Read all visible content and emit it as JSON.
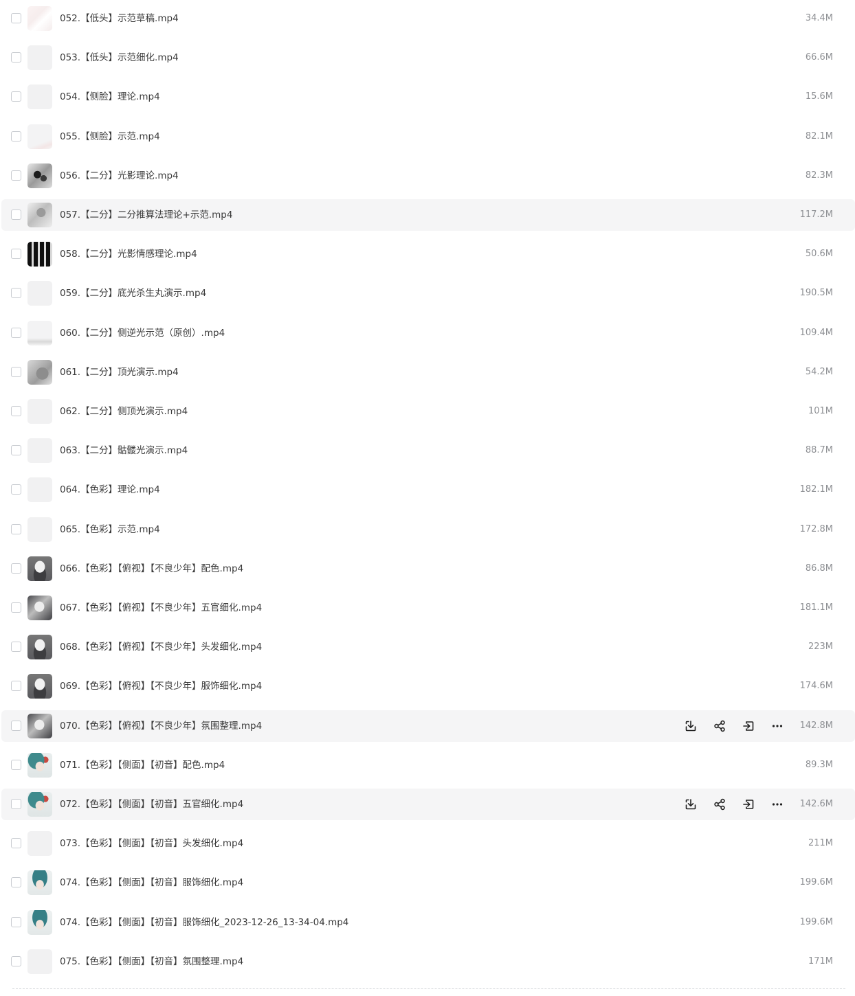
{
  "files": [
    {
      "name": "052.【低头】示范草稿.mp4",
      "size": "34.4M",
      "thumb": "t-sketch"
    },
    {
      "name": "053.【低头】示范细化.mp4",
      "size": "66.6M",
      "thumb": ""
    },
    {
      "name": "054.【侧脸】理论.mp4",
      "size": "15.6M",
      "thumb": ""
    },
    {
      "name": "055.【侧脸】示范.mp4",
      "size": "82.1M",
      "thumb": "t-sketch2"
    },
    {
      "name": "056.【二分】光影理论.mp4",
      "size": "82.3M",
      "thumb": "t-bw"
    },
    {
      "name": "057.【二分】二分推算法理论+示范.mp4",
      "size": "117.2M",
      "thumb": "t-gray",
      "highlighted": true
    },
    {
      "name": "058.【二分】光影情感理论.mp4",
      "size": "50.6M",
      "thumb": "t-grid"
    },
    {
      "name": "059.【二分】底光杀生丸演示.mp4",
      "size": "190.5M",
      "thumb": ""
    },
    {
      "name": "060.【二分】侧逆光示范（原创）.mp4",
      "size": "109.4M",
      "thumb": "t-faint"
    },
    {
      "name": "061.【二分】顶光演示.mp4",
      "size": "54.2M",
      "thumb": "t-rough"
    },
    {
      "name": "062.【二分】侧顶光演示.mp4",
      "size": "101M",
      "thumb": ""
    },
    {
      "name": "063.【二分】骷髅光演示.mp4",
      "size": "88.7M",
      "thumb": ""
    },
    {
      "name": "064.【色彩】理论.mp4",
      "size": "182.1M",
      "thumb": ""
    },
    {
      "name": "065.【色彩】示范.mp4",
      "size": "172.8M",
      "thumb": ""
    },
    {
      "name": "066.【色彩】【俯视】【不良少年】配色.mp4",
      "size": "86.8M",
      "thumb": "t-portrait"
    },
    {
      "name": "067.【色彩】【俯视】【不良少年】五官细化.mp4",
      "size": "181.1M",
      "thumb": "t-portrait2"
    },
    {
      "name": "068.【色彩】【俯视】【不良少年】头发细化.mp4",
      "size": "223M",
      "thumb": "t-portrait"
    },
    {
      "name": "069.【色彩】【俯视】【不良少年】服饰细化.mp4",
      "size": "174.6M",
      "thumb": "t-portrait"
    },
    {
      "name": "070.【色彩】【俯视】【不良少年】氛围整理.mp4",
      "size": "142.8M",
      "thumb": "t-portrait2",
      "highlighted": true,
      "show_actions": true
    },
    {
      "name": "071.【色彩】【侧面】【初音】配色.mp4",
      "size": "89.3M",
      "thumb": "t-teal"
    },
    {
      "name": "072.【色彩】【侧面】【初音】五官细化.mp4",
      "size": "142.6M",
      "thumb": "t-teal",
      "highlighted": true,
      "show_actions": true
    },
    {
      "name": "073.【色彩】【侧面】【初音】头发细化.mp4",
      "size": "211M",
      "thumb": ""
    },
    {
      "name": "074.【色彩】【侧面】【初音】服饰细化.mp4",
      "size": "199.6M",
      "thumb": "t-teal2"
    },
    {
      "name": "074.【色彩】【侧面】【初音】服饰细化_2023-12-26_13-34-04.mp4",
      "size": "199.6M",
      "thumb": "t-teal2"
    },
    {
      "name": "075.【色彩】【侧面】【初音】氛围整理.mp4",
      "size": "171M",
      "thumb": ""
    }
  ],
  "row_actions": [
    "download-icon",
    "share-icon",
    "move-icon",
    "more-icon"
  ],
  "colors": {
    "row_highlight": "#f5f5f6",
    "text": "#3a3a3a",
    "size_text": "#8e9094",
    "icon": "#1f1f1f"
  }
}
